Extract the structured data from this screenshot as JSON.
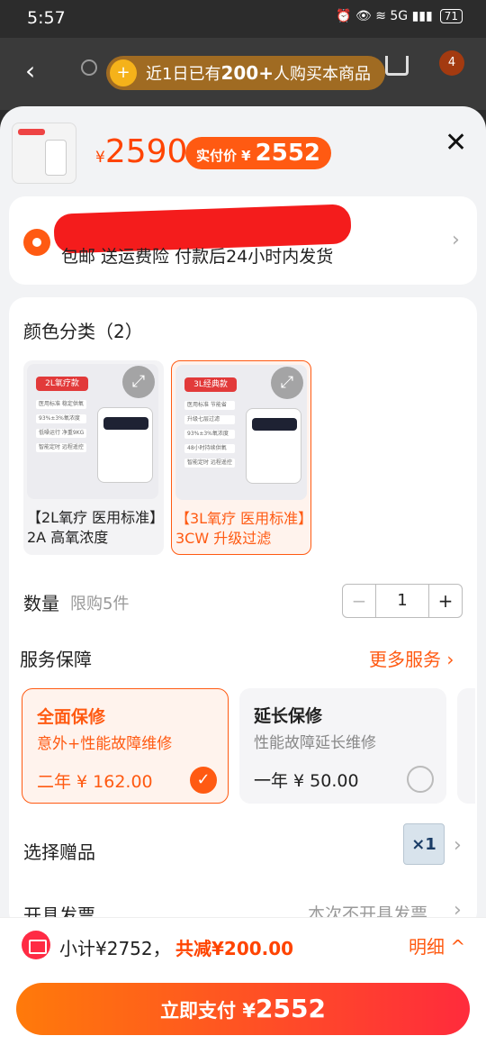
{
  "status_bar": {
    "time": "5:57",
    "icons": "⏰ 👁 ≋ 5G ▮▮▮",
    "battery": "71"
  },
  "toast": {
    "prefix": "近1日已有",
    "count": "200+",
    "suffix": "人购买本商品"
  },
  "header_bg": {
    "cart_badge": "4"
  },
  "product": {
    "price_symbol": "¥",
    "price": "2590",
    "actual_label": "实付价",
    "actual_symbol": "¥",
    "actual_price": "2552",
    "close_glyph": "✕"
  },
  "address": {
    "shipping_info": "包邮 送运费险 付款后24小时内发货"
  },
  "color_section": {
    "title": "颜色分类（2）",
    "options": [
      {
        "badge": "2L氧疗款",
        "caption": "【2L氧疗 医用标准】2A 高氧浓度",
        "bullets": [
          "医用标准 稳定供氧",
          "93%±3%氧浓度",
          "低噪运行 净重9KG",
          "智能定时 远程遥控"
        ]
      },
      {
        "badge": "3L经典款",
        "caption": "【3L氧疗 医用标准】3CW 升级过滤",
        "bullets": [
          "医用标准 节能省",
          "升级七层过滤",
          "93%±3%氧浓度",
          "48小时持续供氧",
          "智能定时 远程遥控"
        ]
      }
    ]
  },
  "quantity": {
    "label": "数量",
    "limit": "限购5件",
    "minus": "−",
    "value": "1",
    "plus": "+"
  },
  "service": {
    "title": "服务保障",
    "more": "更多服务 ›",
    "options": [
      {
        "name": "全面保修",
        "desc": "意外+性能故障维修",
        "price": "二年 ¥ 162.00",
        "selected": true
      },
      {
        "name": "延长保修",
        "desc": "性能故障延长维修",
        "price": "一年 ¥ 50.00",
        "selected": false
      }
    ]
  },
  "gift": {
    "label": "选择赠品",
    "thumb_text": "×1"
  },
  "invoice": {
    "label": "开具发票",
    "value": "本次不开具发票"
  },
  "bottom": {
    "subtotal": "小计¥2752，",
    "discount": "共减¥200.00",
    "detail": "明细 ^",
    "pay_label": "立即支付 ¥",
    "pay_amount": "2552"
  },
  "colors": {
    "accent": "#ff5a12",
    "price": "#ff4400",
    "pay_start": "#ff7a0a",
    "pay_end": "#ff2b3c"
  }
}
